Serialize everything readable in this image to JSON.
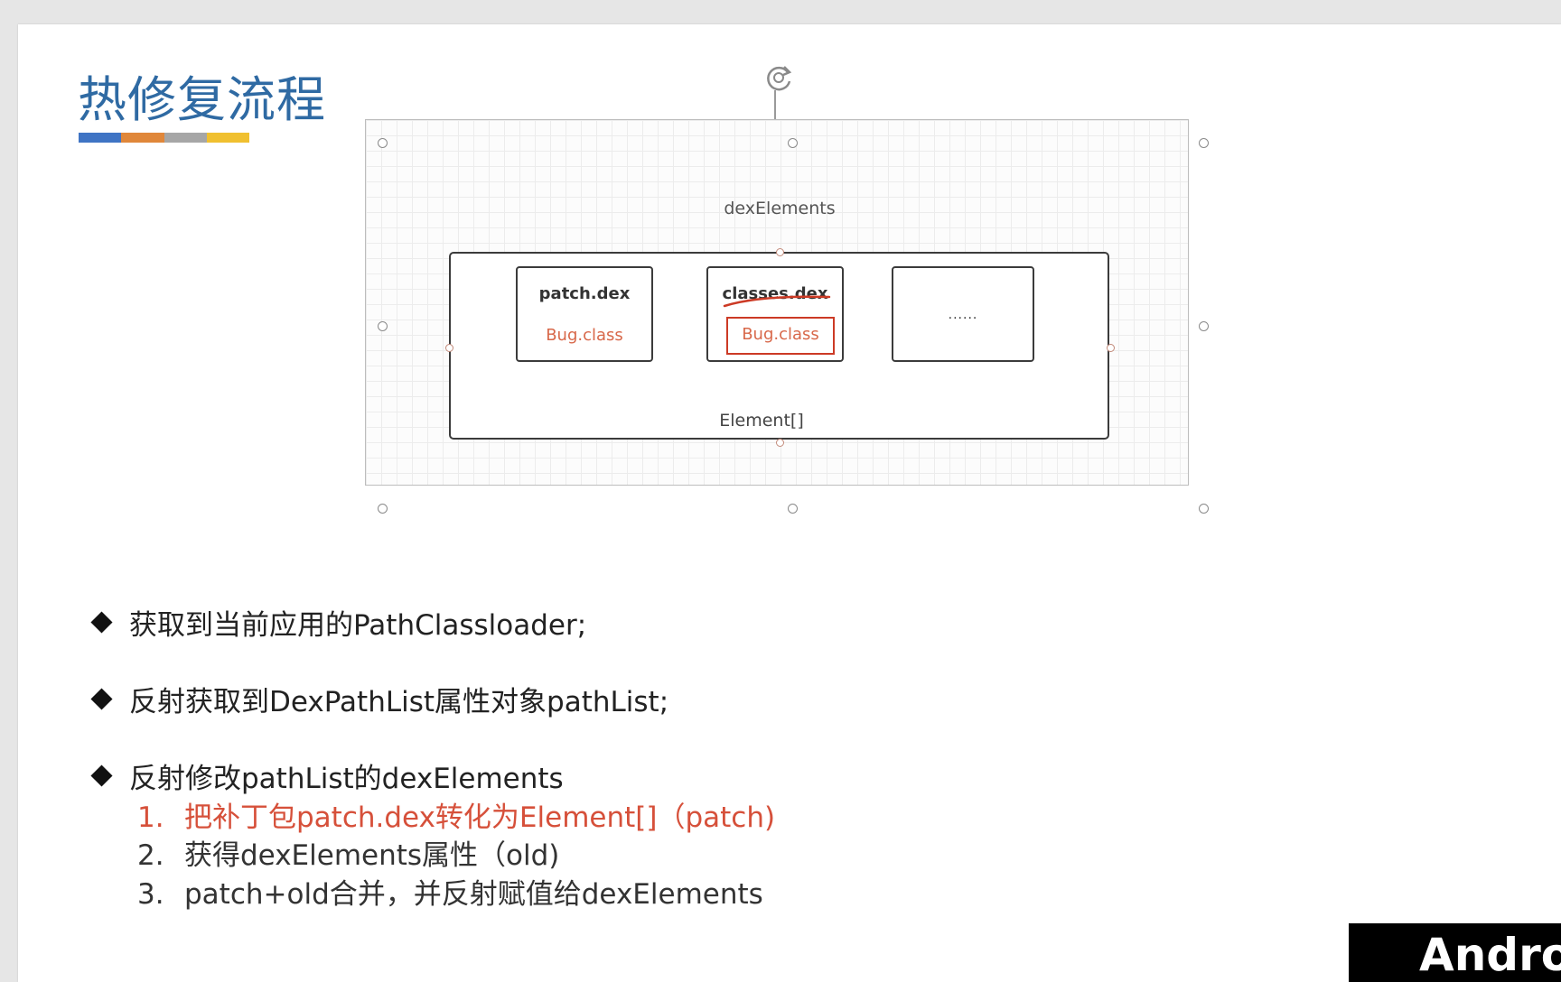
{
  "slide": {
    "title": "热修复流程",
    "title_bar_colors": [
      "#3f74c4",
      "#e0873a",
      "#a6a6a6",
      "#f0c030"
    ]
  },
  "diagram": {
    "outer_label": "dexElements",
    "array_label": "Element[]",
    "boxes": [
      {
        "name": "patch.dex",
        "class": "Bug.class"
      },
      {
        "name": "classes.dex",
        "class": "Bug.class"
      },
      {
        "name": "",
        "class": "......"
      }
    ],
    "accent_color": "#cc3a25"
  },
  "bullets": [
    {
      "text": "获取到当前应用的PathClassloader;"
    },
    {
      "text": "反射获取到DexPathList属性对象pathList;"
    },
    {
      "text": "反射修改pathList的dexElements"
    }
  ],
  "steps": [
    {
      "num": "1.",
      "text": "把补丁包patch.dex转化为Element[]（patch)"
    },
    {
      "num": "2.",
      "text": "获得dexElements属性（old)"
    },
    {
      "num": "3.",
      "text": "patch+old合并，并反射赋值给dexElements"
    }
  ],
  "brand": {
    "text": "Andro"
  }
}
